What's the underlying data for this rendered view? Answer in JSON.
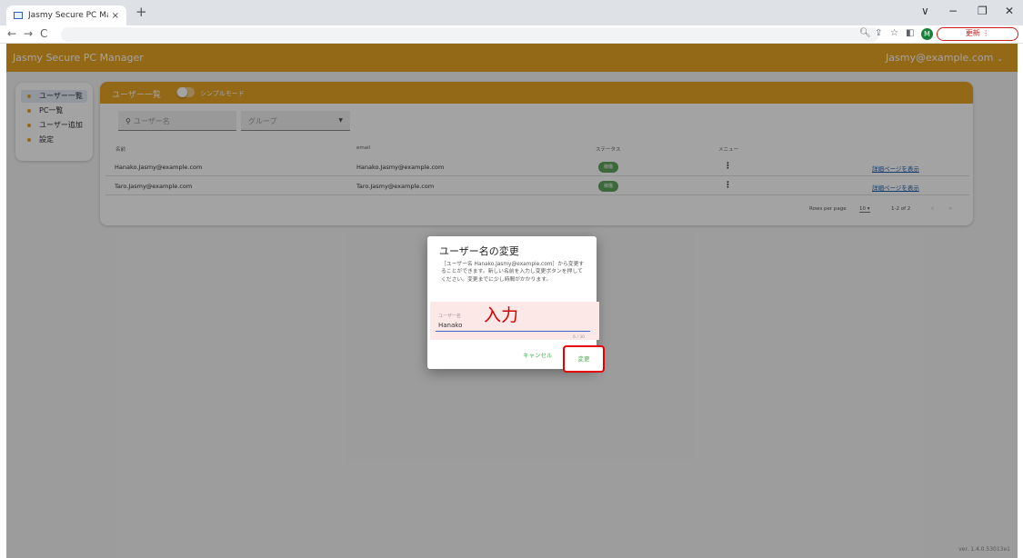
{
  "browser": {
    "tab_title": "Jasmy Secure PC Manager",
    "tab_close": "×",
    "new_tab": "+",
    "profile_initial": "M",
    "update_label": "更新 ⋮",
    "window_controls": [
      "∨",
      "−",
      "❐",
      "✕"
    ]
  },
  "app": {
    "title": "Jasmy Secure PC Manager",
    "user_email": "Jasmy@example.com",
    "version": "ver. 1.4.0.53013e1"
  },
  "sidebar": {
    "items": [
      {
        "label": "ユーザー一覧",
        "active": true
      },
      {
        "label": "PC一覧",
        "active": false
      },
      {
        "label": "ユーザー追加",
        "active": false
      },
      {
        "label": "設定",
        "active": false
      }
    ]
  },
  "card": {
    "title": "ユーザー一覧",
    "mode_label": "シンプルモード",
    "search_placeholder": "ユーザー名",
    "group_placeholder": "グループ",
    "columns": [
      "名前",
      "email",
      "ステータス",
      "メニュー"
    ],
    "rows": [
      {
        "name": "Hanako.Jasmy@example.com",
        "email": "Hanako.Jasmy@example.com",
        "status": "稼働",
        "link": "詳細ページを表示"
      },
      {
        "name": "Taro.Jasmy@example.com",
        "email": "Taro.Jasmy@example.com",
        "status": "稼働",
        "link": "詳細ページを表示"
      }
    ],
    "pager": {
      "rows_per_page_label": "Rows per page",
      "rows_per_page_value": "10",
      "range": "1-2 of 2"
    }
  },
  "dialog": {
    "title": "ユーザー名の変更",
    "body": "［ユーザー名 Hanako.Jasmy@example.com］から変更することができます。新しい名前を入力し変更ボタンを押してください。変更までに少し時間がかかります。",
    "field_label": "ユーザー名",
    "field_value": "Hanako",
    "counter": "6 / 30",
    "annotation": "入力",
    "cancel_label": "キャンセル",
    "confirm_label": "変更"
  },
  "colors": {
    "brand": "#e6a325",
    "highlight": "#e50000"
  }
}
